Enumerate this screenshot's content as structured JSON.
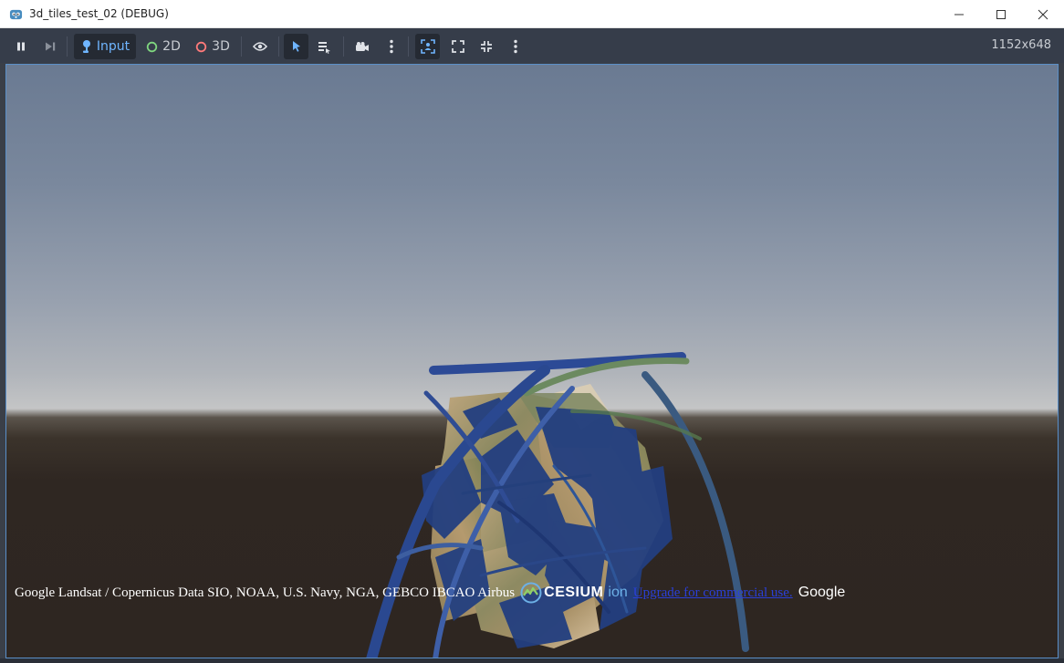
{
  "window": {
    "title": "3d_tiles_test_02 (DEBUG)"
  },
  "toolbar": {
    "input_label": "Input",
    "mode_2d_label": "2D",
    "mode_3d_label": "3D",
    "resolution": "1152x648"
  },
  "icons": {
    "pause": "pause-icon",
    "step": "step-icon",
    "input": "joystick-icon",
    "eye": "eye-icon",
    "select": "select-arrow-icon",
    "list": "list-edit-icon",
    "camera": "camera-icon",
    "more": "kebab-icon",
    "focus": "focus-frame-icon",
    "expand": "expand-icon",
    "shrink": "shrink-icon"
  },
  "viewport": {
    "credits_text": "Google Landsat / Copernicus Data SIO, NOAA, U.S. Navy, NGA, GEBCO IBCAO Airbus",
    "cesium_word": "CESIUM",
    "cesium_ion": "ion",
    "upgrade_link": "Upgrade for commercial use.",
    "google_text": "Google"
  },
  "colors": {
    "toolbar_bg": "#363d4a",
    "accent": "#6fb5ff",
    "mode_2d": "#7fd67f",
    "mode_3d": "#ff7a7a",
    "link": "#2a3fd8"
  }
}
